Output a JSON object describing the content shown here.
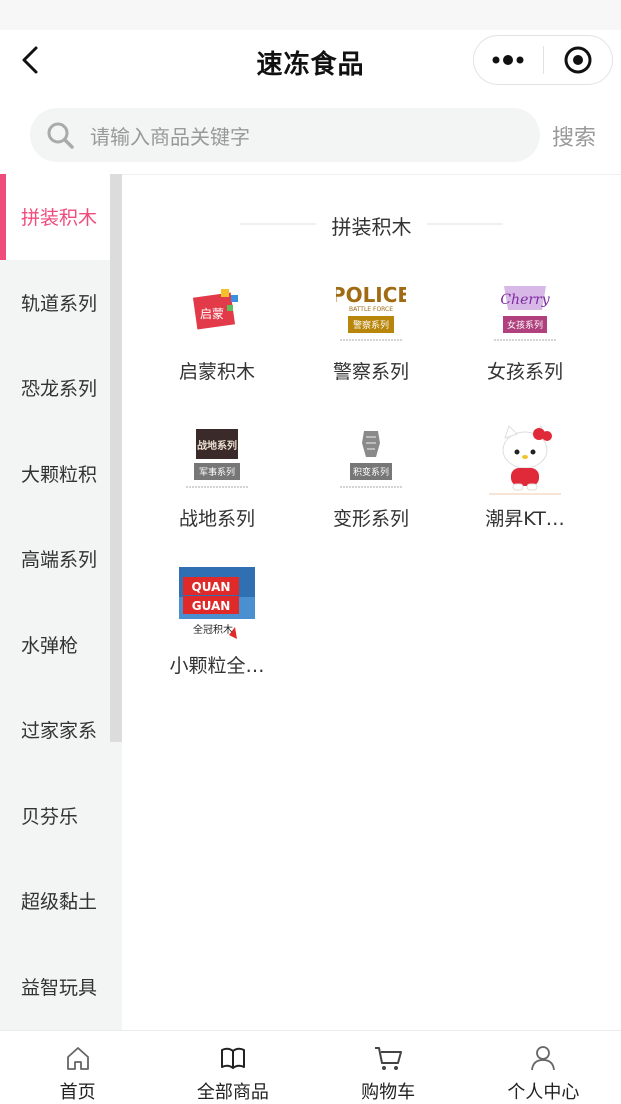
{
  "nav": {
    "title": "速冻食品",
    "back_icon": "chevron-left-icon",
    "more_icon": "more-dots-icon",
    "close_icon": "target-circle-icon"
  },
  "search": {
    "placeholder": "请输入商品关键字",
    "button_label": "搜索"
  },
  "sidebar": {
    "active_index": 0,
    "accent_color": "#ef4c7c",
    "items": [
      {
        "label": "拼装积木"
      },
      {
        "label": "轨道系列"
      },
      {
        "label": "恐龙系列"
      },
      {
        "label": "大颗粒积"
      },
      {
        "label": "高端系列"
      },
      {
        "label": "水弹枪"
      },
      {
        "label": "过家家系"
      },
      {
        "label": "贝芬乐"
      },
      {
        "label": "超级黏土"
      },
      {
        "label": "益智玩具"
      }
    ]
  },
  "content": {
    "section_title": "拼装积木",
    "products": [
      {
        "label": "启蒙积木",
        "logo_text": "启蒙"
      },
      {
        "label": "警察系列",
        "logo_text": "POLICE",
        "logo_sub": "BATTLE FORCE",
        "badge": "警察系列",
        "badge_color": "#b8860b"
      },
      {
        "label": "女孩系列",
        "logo_text": "Cherry",
        "badge": "女孩系列",
        "badge_color": "#b0407e"
      },
      {
        "label": "战地系列",
        "logo_text": "战地系列",
        "badge": "军事系列",
        "badge_color": "#777777"
      },
      {
        "label": "变形系列",
        "badge": "积变系列",
        "badge_color": "#777777"
      },
      {
        "label": "潮昇KT…"
      },
      {
        "label": "小颗粒全…",
        "logo_text": "QUAN GUAN",
        "logo_sub": "全冠积木"
      }
    ]
  },
  "tabbar": {
    "tabs": [
      {
        "label": "首页",
        "icon": "home-icon"
      },
      {
        "label": "全部商品",
        "icon": "book-icon"
      },
      {
        "label": "购物车",
        "icon": "cart-icon"
      },
      {
        "label": "个人中心",
        "icon": "user-icon"
      }
    ]
  }
}
